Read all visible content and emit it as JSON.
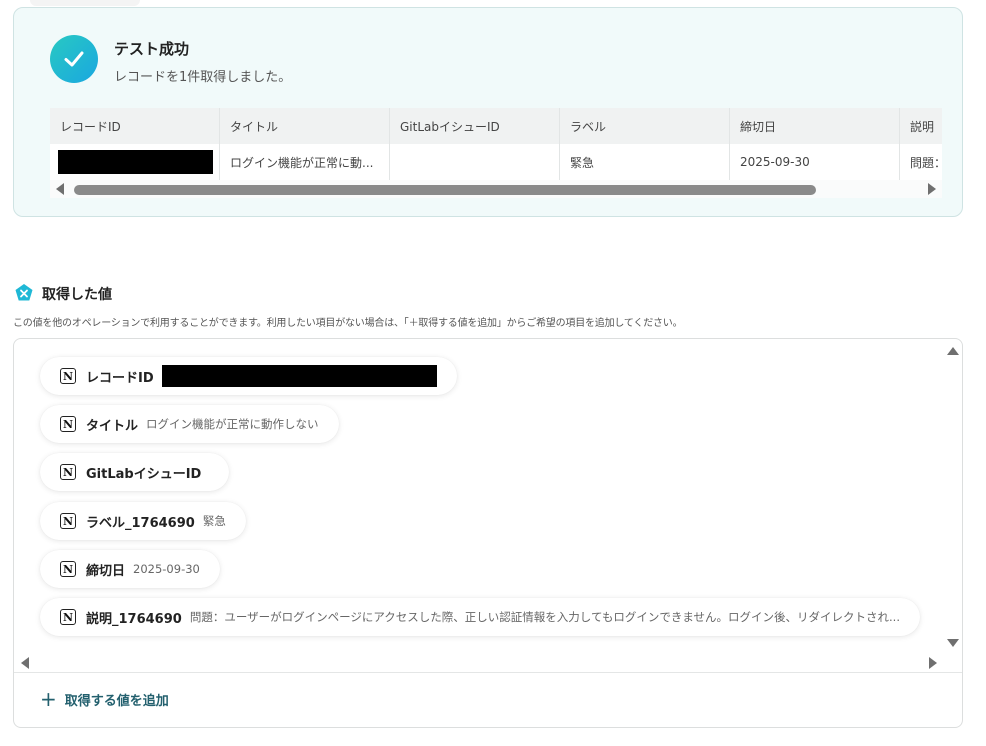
{
  "success": {
    "title": "テスト成功",
    "subtitle": "レコードを1件取得しました。"
  },
  "table": {
    "headers": [
      "レコードID",
      "タイトル",
      "GitLabイシューID",
      "ラベル",
      "締切日",
      "説明"
    ],
    "row": [
      "",
      "ログイン機能が正常に動...",
      "",
      "緊急",
      "2025-09-30",
      "問題："
    ]
  },
  "section": {
    "title": "取得した値",
    "description": "この値を他のオペレーションで利用することができます。利用したい項目がない場合は、「＋取得する値を追加」からご希望の項目を追加してください。"
  },
  "values": [
    {
      "key": "レコードID",
      "value": ""
    },
    {
      "key": "タイトル",
      "value": "ログイン機能が正常に動作しない"
    },
    {
      "key": "GitLabイシューID",
      "value": ""
    },
    {
      "key": "ラベル_1764690",
      "value": "緊急"
    },
    {
      "key": "締切日",
      "value": "2025-09-30"
    },
    {
      "key": "説明_1764690",
      "value": "問題：ユーザーがログインページにアクセスした際、正しい認証情報を入力してもログインできません。ログイン後、リダイレクトされ..."
    }
  ],
  "add_button": {
    "label": "取得する値を追加"
  },
  "icons": {
    "check": "check-icon",
    "notion": "notion-icon",
    "section": "variable-icon"
  },
  "colors": {
    "accent": "#1fb8d6",
    "link": "#23606e",
    "success_bg": "#f1fafa"
  }
}
